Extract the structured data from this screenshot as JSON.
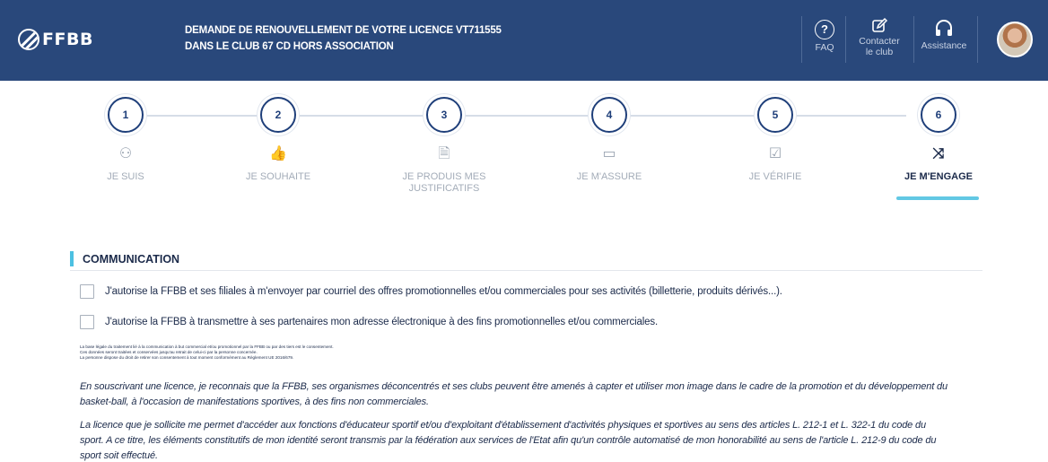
{
  "header": {
    "logo_text": "FFBB",
    "title_line1": "DEMANDE DE RENOUVELLEMENT DE VOTRE LICENCE VT711555",
    "title_line2": "DANS LE CLUB 67 CD HORS ASSOCIATION",
    "actions": [
      {
        "icon": "question-circle-icon",
        "label": "FAQ"
      },
      {
        "icon": "edit-icon",
        "label_line1": "Contacter",
        "label_line2": "le club"
      },
      {
        "icon": "headphones-icon",
        "label": "Assistance"
      }
    ],
    "colors": {
      "background": "#29487b",
      "text": "#ffffff"
    }
  },
  "stepper": {
    "active_step": 6,
    "accent_color": "#62c8e4",
    "steps": [
      {
        "number": "1",
        "icon": "user-plus-icon",
        "glyph": "⚇",
        "label": "JE SUIS"
      },
      {
        "number": "2",
        "icon": "thumbs-up-icon",
        "glyph": "👍",
        "label": "JE SOUHAITE"
      },
      {
        "number": "3",
        "icon": "document-icon",
        "glyph": "🗎",
        "label_line1": "JE PRODUIS MES",
        "label_line2": "JUSTIFICATIFS"
      },
      {
        "number": "4",
        "icon": "book-icon",
        "glyph": "▭",
        "label": "JE M'ASSURE"
      },
      {
        "number": "5",
        "icon": "check-square-icon",
        "glyph": "☑",
        "label": "JE VÉRIFIE"
      },
      {
        "number": "6",
        "icon": "shuffle-icon",
        "glyph": "⤨",
        "label": "JE M'ENGAGE"
      }
    ]
  },
  "communication": {
    "title": "COMMUNICATION",
    "checkbox_1": "J'autorise la FFBB et ses filiales à m'envoyer par courriel des offres promotionnelles et/ou commerciales pour ses activités (billetterie, produits dérivés...).",
    "checkbox_2": "J'autorise la FFBB à transmettre à ses partenaires mon adresse électronique à des fins promotionnelles et/ou commerciales.",
    "fine_print": [
      "La base légale du traitement lié à la communication à but commercial et/ou promotionnel par la FFBB ou par des tiers est le consentement.",
      "Ces données seront traitées et conservées jusqu'au retrait de celui-ci par la personne concernée.",
      "La personne dispose du droit de retirer son consentement à tout moment conformément au Règlement UE 2016/679."
    ],
    "paragraph_1_line1": "En souscrivant une licence, je reconnais que la FFBB, ses organismes déconcentrés et ses clubs peuvent être amenés à capter et utiliser mon image dans le cadre de la promotion et du développement du",
    "paragraph_1_line2": "basket-ball, à l'occasion de manifestations sportives, à des fins non commerciales.",
    "paragraph_2_line1": "La licence que je sollicite me permet d'accéder aux fonctions d'éducateur sportif et/ou d'exploitant d'établissement d'activités physiques et sportives au sens des articles L. 212-1 et L. 322-1 du code du",
    "paragraph_2_line2": "sport. A ce titre, les éléments constitutifs de mon identité seront transmis par la fédération aux services de l'Etat afin qu'un contrôle automatisé de mon honorabilité au sens de l'article L. 212-9 du code du",
    "paragraph_2_line3": "sport soit effectué."
  }
}
